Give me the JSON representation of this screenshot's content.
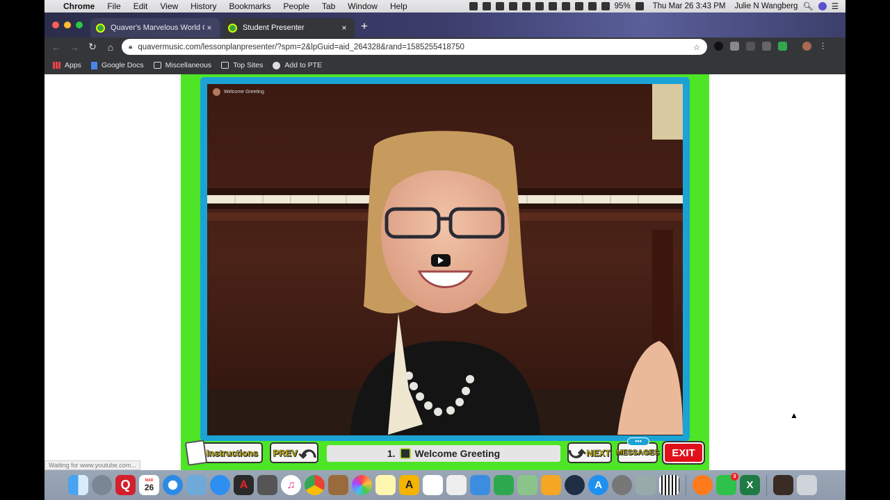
{
  "menubar": {
    "apple": "",
    "app_name": "Chrome",
    "items": [
      "File",
      "Edit",
      "View",
      "History",
      "Bookmarks",
      "People",
      "Tab",
      "Window",
      "Help"
    ],
    "battery": "95%",
    "datetime": "Thu Mar 26  3:43 PM",
    "user": "Julie N Wangberg"
  },
  "browser": {
    "tabs": [
      {
        "title": "Quaver's Marvelous World Of M",
        "close": "×"
      },
      {
        "title": "Student Presenter",
        "close": "×"
      }
    ],
    "new_tab": "+",
    "url": "quavermusic.com/lessonplanpresenter/?spm=2&lpGuid=aid_264328&rand=1585255418750",
    "bookmarks": [
      "Apps",
      "Google Docs",
      "Miscellaneous",
      "Top Sites",
      "Add to PTE"
    ],
    "status": "Waiting for www.youtube.com..."
  },
  "presenter": {
    "video_title": "Welcome Greeting",
    "instructions_label": "Instructions",
    "prev_label": "PREV",
    "slide_number": "1.",
    "slide_title": "Welcome Greeting",
    "next_label": "NEXT",
    "messages_label": "MESSAGES",
    "messages_dots": "•••",
    "exit_label": "EXIT"
  },
  "dock": {
    "calendar_month": "MAR",
    "calendar_day": "26",
    "facetime_badge": "3"
  },
  "colors": {
    "stage_green": "#4ee527",
    "frame_blue": "#1ba3d6",
    "exit_red": "#e0101a",
    "button_yellow": "#f8e000"
  }
}
